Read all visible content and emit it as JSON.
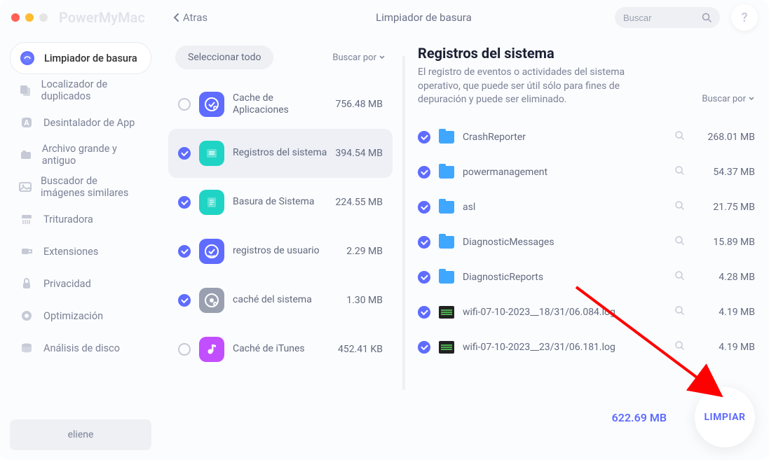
{
  "app_name": "PowerMyMac",
  "back_label": "Atras",
  "top_title": "Limpiador de basura",
  "search_placeholder": "Buscar",
  "help_symbol": "?",
  "sidebar": {
    "items": [
      {
        "label": "Limpiador de basura",
        "icon": "junk",
        "active": true
      },
      {
        "label": "Localizador de duplicados",
        "icon": "dup"
      },
      {
        "label": "Desintalador de App",
        "icon": "uninstall"
      },
      {
        "label": "Archivo grande y antiguo",
        "icon": "large"
      },
      {
        "label": "Buscador de imágenes similares",
        "icon": "images"
      },
      {
        "label": "Trituradora",
        "icon": "shred"
      },
      {
        "label": "Extensiones",
        "icon": "ext"
      },
      {
        "label": "Privacidad",
        "icon": "privacy"
      },
      {
        "label": "Optimización",
        "icon": "optim"
      },
      {
        "label": "Análisis de disco",
        "icon": "disk"
      }
    ],
    "user": "eliene"
  },
  "middle": {
    "select_all": "Seleccionar todo",
    "sort_label": "Buscar por",
    "categories": [
      {
        "label": "Cache de Aplicaciones",
        "size": "756.48 MB",
        "checked": false,
        "icon_bg": "#5f6cff"
      },
      {
        "label": "Registros del sistema",
        "size": "394.54 MB",
        "checked": true,
        "selected": true,
        "icon_bg": "#1fd4c4"
      },
      {
        "label": "Basura de Sistema",
        "size": "224.55 MB",
        "checked": true,
        "icon_bg": "#1fd4c4"
      },
      {
        "label": "registros de usuario",
        "size": "2.29 MB",
        "checked": true,
        "icon_bg": "#5f6cff"
      },
      {
        "label": "caché del sistema",
        "size": "1.30 MB",
        "checked": true,
        "icon_bg": "#9aa0b0"
      },
      {
        "label": "Caché de iTunes",
        "size": "452.41 KB",
        "checked": false,
        "icon_bg": "#c24fff"
      }
    ]
  },
  "detail": {
    "title": "Registros del sistema",
    "desc": "El registro de eventos o actividades del sistema operativo, que puede ser útil sólo para fines de depuración y puede ser eliminado.",
    "sort_label": "Buscar por",
    "files": [
      {
        "name": "CrashReporter",
        "size": "268.01 MB",
        "type": "folder"
      },
      {
        "name": "powermanagement",
        "size": "54.37 MB",
        "type": "folder"
      },
      {
        "name": "asl",
        "size": "21.75 MB",
        "type": "folder"
      },
      {
        "name": "DiagnosticMessages",
        "size": "15.89 MB",
        "type": "folder"
      },
      {
        "name": "DiagnosticReports",
        "size": "4.28 MB",
        "type": "folder"
      },
      {
        "name": "wifi-07-10-2023__18/31/06.084.log",
        "size": "4.19 MB",
        "type": "log"
      },
      {
        "name": "wifi-07-10-2023__23/31/06.181.log",
        "size": "4.19 MB",
        "type": "log"
      }
    ],
    "total": "622.69 MB",
    "clean_label": "LIMPIAR"
  },
  "colors": {
    "accent": "#5f6cff",
    "arrow": "#ff0000"
  }
}
